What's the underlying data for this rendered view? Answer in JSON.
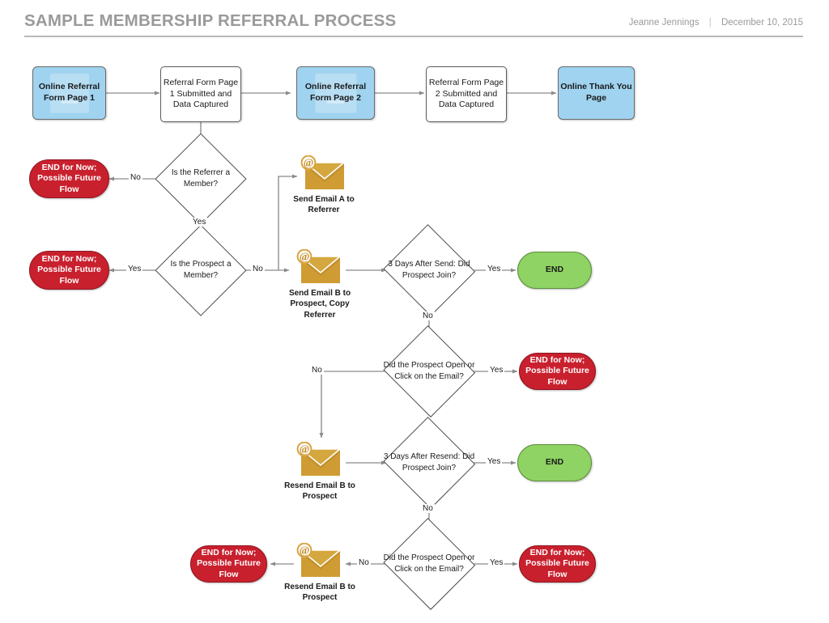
{
  "header": {
    "title": "SAMPLE MEMBERSHIP REFERRAL PROCESS",
    "author": "Jeanne Jennings",
    "separator": "|",
    "date": "December 10, 2015"
  },
  "colors": {
    "page_box_blue": "#9fd3ef",
    "end_red": "#c9202e",
    "end_green": "#8ed363",
    "email_gold": "#cf9c33",
    "connector_gray": "#8a8a8a",
    "header_gray": "#9a9a9a"
  },
  "nodes": {
    "online_referral_form_page_1": "Online Referral Form Page 1",
    "referral_form_page_1_submitted": "Referral Form Page 1 Submitted and Data Captured",
    "online_referral_form_page_2": "Online Referral Form Page 2",
    "referral_form_page_2_submitted": "Referral Form Page 2 Submitted and Data Captured",
    "online_thank_you_page": "Online Thank You Page",
    "is_referrer_member": "Is the Referrer a Member?",
    "is_prospect_member": "Is the Prospect a Member?",
    "three_days_after_send": "3 Days After Send: Did Prospect Join?",
    "three_days_after_resend": "3 Days After Resend: Did Prospect Join?",
    "did_open_or_click_1": "Did the Prospect Open or Click on the Email?",
    "did_open_or_click_2": "Did the Prospect Open or Click on the Email?",
    "send_email_a": "Send Email A to Referrer",
    "send_email_b": "Send Email B to Prospect, Copy Referrer",
    "resend_email_b_1": "Resend Email B to Prospect",
    "resend_email_b_2": "Resend Email B to Prospect",
    "end_referrer_not_member": "END for Now; Possible Future Flow",
    "end_prospect_is_member": "END for Now; Possible Future Flow",
    "end_joined_after_send": "END",
    "end_opened_no_join_1": "END for Now; Possible Future Flow",
    "end_joined_after_resend": "END",
    "end_opened_no_join_2": "END for Now; Possible Future Flow",
    "end_no_engagement": "END for Now; Possible Future Flow"
  },
  "edge_labels": {
    "referrer_no": "No",
    "referrer_yes": "Yes",
    "prospect_yes": "Yes",
    "prospect_no": "No",
    "after_send_yes": "Yes",
    "after_send_no": "No",
    "open_click_1_yes": "Yes",
    "open_click_1_no": "No",
    "after_resend_yes": "Yes",
    "after_resend_no": "No",
    "open_click_2_yes": "Yes",
    "open_click_2_no": "No"
  },
  "icons": {
    "email_at_badge": "@"
  }
}
